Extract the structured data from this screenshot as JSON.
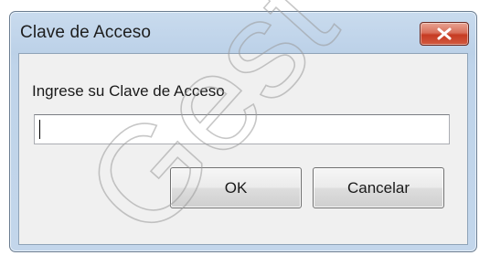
{
  "dialog": {
    "title": "Clave de Acceso",
    "prompt": "Ingrese su Clave de Acceso",
    "password_value": "",
    "ok_label": "OK",
    "cancel_label": "Cancelar"
  },
  "colors": {
    "frame": "#bfd4ea",
    "client_bg": "#f0f0f0",
    "close_red": "#c63b22"
  },
  "icons": {
    "close": "close-icon"
  },
  "watermark": {
    "text": "Gest"
  }
}
